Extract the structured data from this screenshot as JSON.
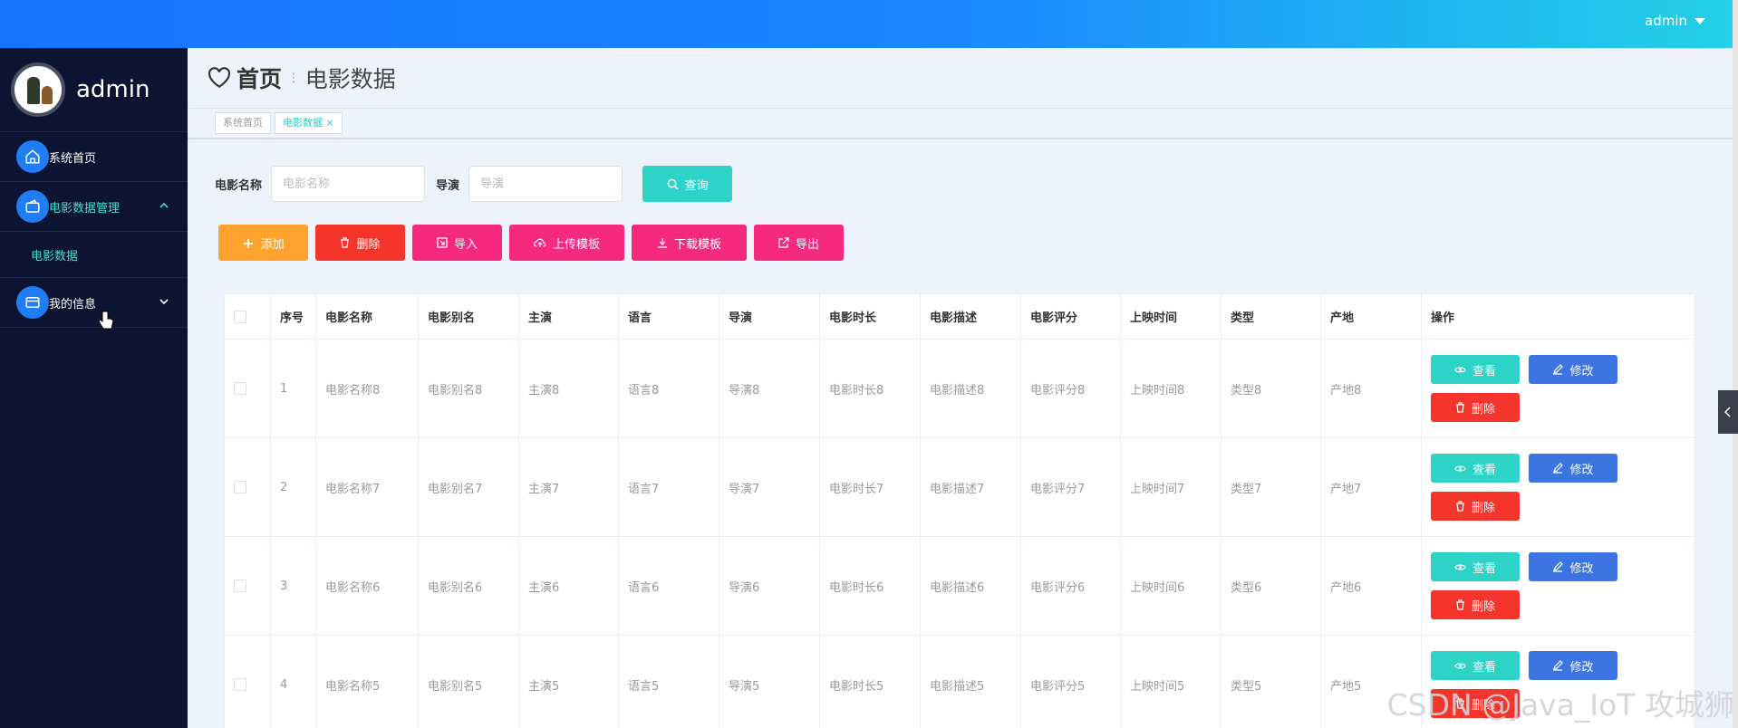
{
  "header": {
    "username": "admin"
  },
  "sidebar": {
    "profile_name": "admin",
    "items": [
      {
        "label": "系统首页"
      },
      {
        "label": "电影数据管理"
      },
      {
        "label": "我的信息"
      }
    ],
    "subitem": "电影数据"
  },
  "page": {
    "home": "首页",
    "current": "电影数据",
    "sep": "⁝"
  },
  "tags": [
    "系统首页",
    "电影数据"
  ],
  "search": {
    "name_label": "电影名称",
    "name_placeholder": "电影名称",
    "director_label": "导演",
    "director_placeholder": "导演",
    "query_label": "查询"
  },
  "actions": {
    "add": "添加",
    "delete": "删除",
    "import": "导入",
    "upload_template": "上传模板",
    "download_template": "下载模板",
    "export": "导出"
  },
  "table": {
    "headers": [
      "序号",
      "电影名称",
      "电影别名",
      "主演",
      "语言",
      "导演",
      "电影时长",
      "电影描述",
      "电影评分",
      "上映时间",
      "类型",
      "产地",
      "操作"
    ],
    "rows": [
      [
        "1",
        "电影名称8",
        "电影别名8",
        "主演8",
        "语言8",
        "导演8",
        "电影时长8",
        "电影描述8",
        "电影评分8",
        "上映时间8",
        "类型8",
        "产地8"
      ],
      [
        "2",
        "电影名称7",
        "电影别名7",
        "主演7",
        "语言7",
        "导演7",
        "电影时长7",
        "电影描述7",
        "电影评分7",
        "上映时间7",
        "类型7",
        "产地7"
      ],
      [
        "3",
        "电影名称6",
        "电影别名6",
        "主演6",
        "语言6",
        "导演6",
        "电影时长6",
        "电影描述6",
        "电影评分6",
        "上映时间6",
        "类型6",
        "产地6"
      ],
      [
        "4",
        "电影名称5",
        "电影别名5",
        "主演5",
        "语言5",
        "导演5",
        "电影时长5",
        "电影描述5",
        "电影评分5",
        "上映时间5",
        "类型5",
        "产地5"
      ]
    ],
    "row_actions": {
      "view": "查看",
      "edit": "修改",
      "delete": "删除"
    }
  },
  "watermark": "CSDN @Java_IoT 攻城狮",
  "colors": {
    "sidebar_bg": "#0d1431",
    "accent_cyan": "#2ed3c8",
    "edit_blue": "#3c75e2",
    "danger_red": "#f5352c",
    "pink": "#f5297e",
    "orange": "#ffa22e"
  }
}
